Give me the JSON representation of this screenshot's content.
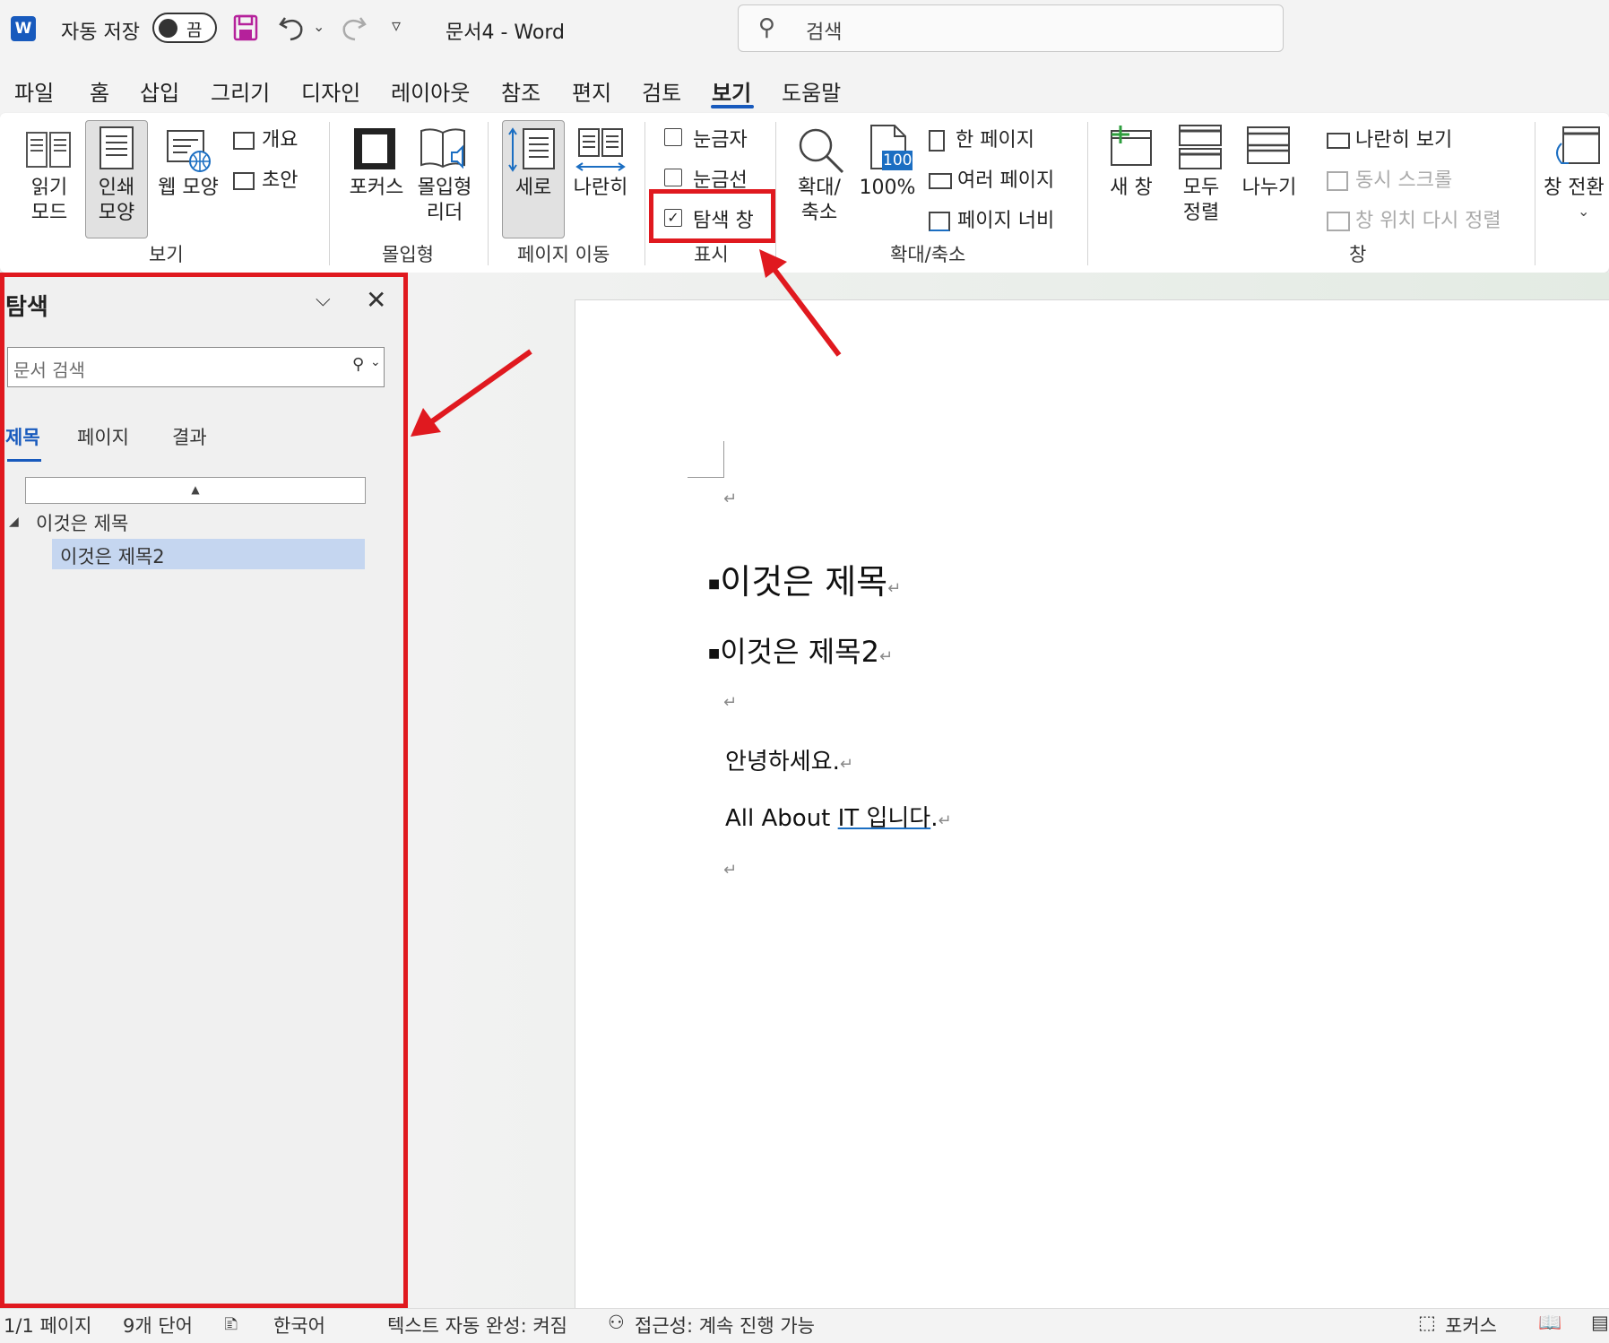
{
  "titlebar": {
    "app_icon_letter": "W",
    "autosave_label": "자동 저장",
    "autosave_state": "끔",
    "doc_title": "문서4  -  Word",
    "search_placeholder": "검색"
  },
  "menu_tabs": [
    "파일",
    "홈",
    "삽입",
    "그리기",
    "디자인",
    "레이아웃",
    "참조",
    "편지",
    "검토",
    "보기",
    "도움말"
  ],
  "active_tab": "보기",
  "ribbon": {
    "view_group": {
      "label": "보기",
      "read_mode": [
        "읽기",
        "모드"
      ],
      "print_layout": [
        "인쇄",
        "모양"
      ],
      "web_layout": "웹 모양",
      "outline": "개요",
      "draft": "초안"
    },
    "immersive_group": {
      "label": "몰입형",
      "focus": "포커스",
      "immersive_reader": [
        "몰입형",
        "리더"
      ]
    },
    "page_move_group": {
      "label": "페이지 이동",
      "vertical": "세로",
      "side_to_side": "나란히"
    },
    "show_group": {
      "label": "표시",
      "ruler": "눈금자",
      "gridlines": "눈금선",
      "nav_pane": "탐색 창",
      "ruler_checked": false,
      "gridlines_checked": false,
      "nav_pane_checked": true
    },
    "zoom_group": {
      "label": "확대/축소",
      "zoom": [
        "확대/",
        "축소"
      ],
      "hundred_icon": "100",
      "hundred": "100%",
      "one_page": "한 페이지",
      "multiple_pages": "여러 페이지",
      "page_width": "페이지 너비"
    },
    "window_group": {
      "label": "창",
      "new_window": "새 창",
      "arrange_all": [
        "모두",
        "정렬"
      ],
      "split": "나누기",
      "side_by_side": "나란히 보기",
      "sync_scroll": "동시 스크롤",
      "reset_position": "창 위치 다시 정렬",
      "switch_windows": "창 전환"
    }
  },
  "nav_pane": {
    "title": "탐색",
    "search_placeholder": "문서 검색",
    "tabs": [
      "제목",
      "페이지",
      "결과"
    ],
    "active_tab": "제목",
    "headings": [
      "이것은 제목",
      "이것은 제목2"
    ],
    "selected_heading": "이것은 제목2"
  },
  "document": {
    "heading1": "이것은  제목",
    "heading2": "이것은  제목2",
    "line1": "안녕하세요.",
    "line2_prefix": "All About ",
    "line2_underlined": "IT  입니다",
    "line2_suffix": ".",
    "para_mark": "↵"
  },
  "statusbar": {
    "page": "1/1 페이지",
    "words": "9개 단어",
    "language": "한국어",
    "autocomplete": "텍스트 자동 완성: 켜짐",
    "accessibility": "접근성: 계속 진행 가능",
    "focus": "포커스"
  },
  "colors": {
    "accent": "#185abd",
    "annotation": "#e0191f",
    "selection": "#c5d6f0"
  }
}
